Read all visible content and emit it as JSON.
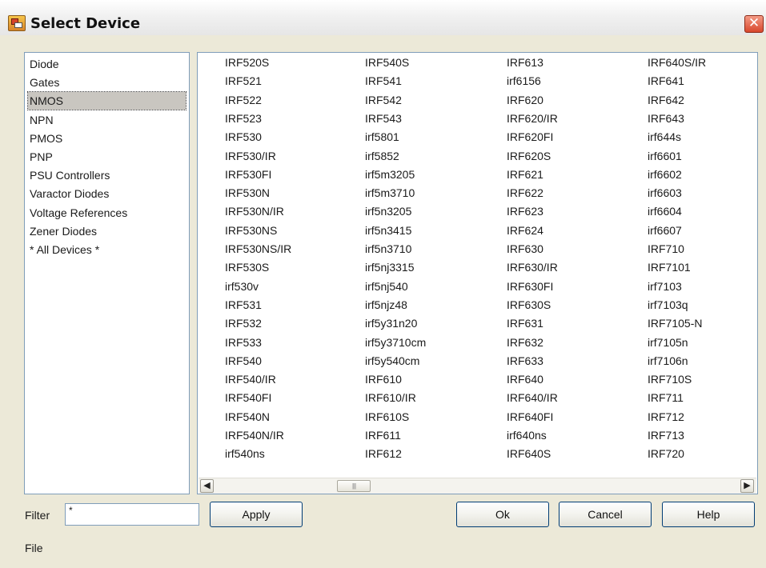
{
  "window": {
    "title": "Select Device",
    "close_glyph": "✕"
  },
  "categories": {
    "selected": "NMOS",
    "items": [
      "Diode",
      "Gates",
      "NMOS",
      "NPN",
      "PMOS",
      "PNP",
      "PSU Controllers",
      "Varactor Diodes",
      "Voltage References",
      "Zener Diodes",
      "* All Devices *"
    ]
  },
  "devices": {
    "columns": [
      [
        "IRF520S",
        "IRF521",
        "IRF522",
        "IRF523",
        "IRF530",
        "IRF530/IR",
        "IRF530FI",
        "IRF530N",
        "IRF530N/IR",
        "IRF530NS",
        "IRF530NS/IR",
        "IRF530S",
        "irf530v",
        "IRF531",
        "IRF532",
        "IRF533",
        "IRF540",
        "IRF540/IR",
        "IRF540FI",
        "IRF540N",
        "IRF540N/IR",
        "irf540ns"
      ],
      [
        "IRF540S",
        "IRF541",
        "IRF542",
        "IRF543",
        "irf5801",
        "irf5852",
        "irf5m3205",
        "irf5m3710",
        "irf5n3205",
        "irf5n3415",
        "irf5n3710",
        "irf5nj3315",
        "irf5nj540",
        "irf5njz48",
        "irf5y31n20",
        "irf5y3710cm",
        "irf5y540cm",
        "IRF610",
        "IRF610/IR",
        "IRF610S",
        "IRF611",
        "IRF612"
      ],
      [
        "IRF613",
        "irf6156",
        "IRF620",
        "IRF620/IR",
        "IRF620FI",
        "IRF620S",
        "IRF621",
        "IRF622",
        "IRF623",
        "IRF624",
        "IRF630",
        "IRF630/IR",
        "IRF630FI",
        "IRF630S",
        "IRF631",
        "IRF632",
        "IRF633",
        "IRF640",
        "IRF640/IR",
        "IRF640FI",
        "irf640ns",
        "IRF640S"
      ],
      [
        "IRF640S/IR",
        "IRF641",
        "IRF642",
        "IRF643",
        "irf644s",
        "irf6601",
        "irf6602",
        "irf6603",
        "irf6604",
        "irf6607",
        "IRF710",
        "IRF7101",
        "irf7103",
        "irf7103q",
        "IRF7105-N",
        "irf7105n",
        "irf7106n",
        "IRF710S",
        "IRF711",
        "IRF712",
        "IRF713",
        "IRF720"
      ]
    ],
    "scrollbar": {
      "left_arrow": "◀",
      "right_arrow": "▶",
      "thumb_grip": "||||"
    }
  },
  "filter": {
    "label": "Filter",
    "value": "*"
  },
  "buttons": {
    "apply": "Apply",
    "ok": "Ok",
    "cancel": "Cancel",
    "help": "Help"
  },
  "status": {
    "text": "File"
  },
  "colors": {
    "dialog_bg": "#ece9d8",
    "list_border": "#7f9db9",
    "button_border": "#003c74",
    "close_red": "#d8472c",
    "selection_gray": "#c9c6c0"
  }
}
